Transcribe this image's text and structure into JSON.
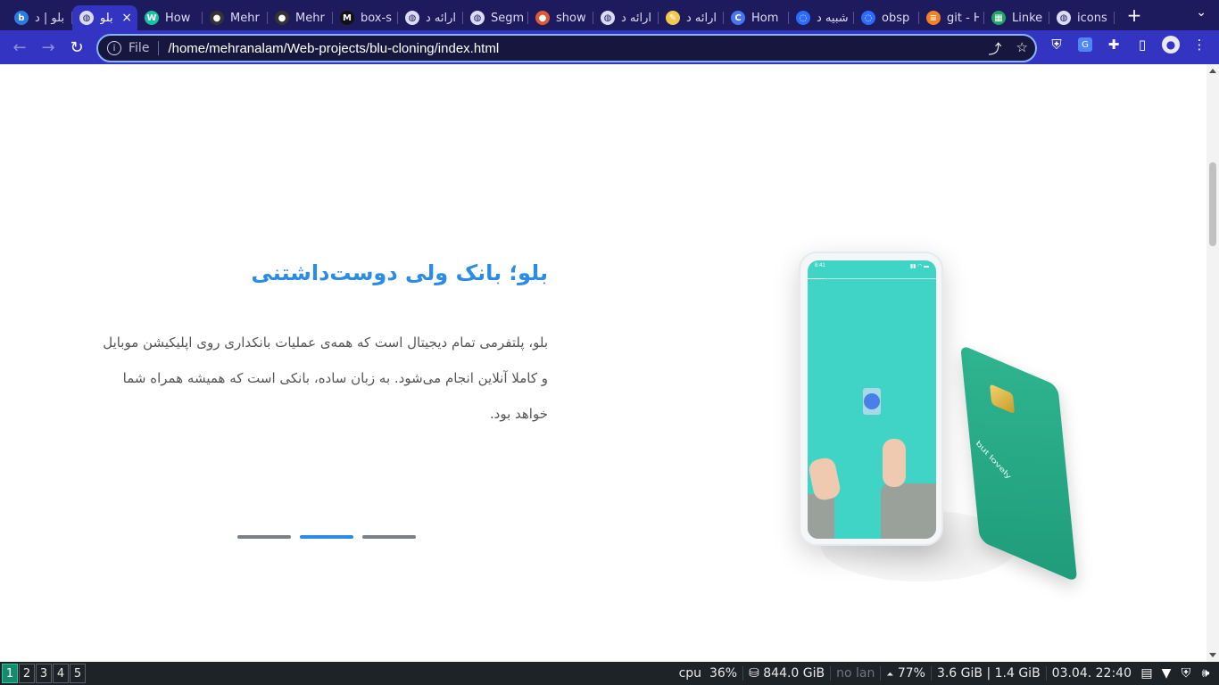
{
  "browser": {
    "tabs": [
      {
        "title": "بلو | د",
        "icon": "blu-favicon",
        "color": "#2a7be4",
        "glyph": "b",
        "active": false
      },
      {
        "title": "بلو",
        "icon": "globe-icon",
        "color": "#dcdcf5",
        "glyph": "◍",
        "active": true
      },
      {
        "title": "How",
        "icon": "w-favicon",
        "color": "#18c2a0",
        "glyph": "W",
        "active": false
      },
      {
        "title": "Mehr",
        "icon": "github-icon",
        "color": "#333333",
        "glyph": "●",
        "active": false
      },
      {
        "title": "Mehr",
        "icon": "github-icon",
        "color": "#333333",
        "glyph": "●",
        "active": false
      },
      {
        "title": "box-s",
        "icon": "m-favicon",
        "color": "#111111",
        "glyph": "M",
        "active": false
      },
      {
        "title": "ارائه د",
        "icon": "globe-icon",
        "color": "#dcdcf5",
        "glyph": "◍",
        "active": false
      },
      {
        "title": "Segm",
        "icon": "globe-icon",
        "color": "#dcdcf5",
        "glyph": "◍",
        "active": false
      },
      {
        "title": "show",
        "icon": "duckduckgo-icon",
        "color": "#de5833",
        "glyph": "●",
        "active": false
      },
      {
        "title": "ارائه د",
        "icon": "globe-icon",
        "color": "#dcdcf5",
        "glyph": "◍",
        "active": false
      },
      {
        "title": "ارائه د",
        "icon": "notes-icon",
        "color": "#f2c94c",
        "glyph": "✎",
        "active": false
      },
      {
        "title": "Hom",
        "icon": "c-favicon",
        "color": "#4a74f0",
        "glyph": "C",
        "active": false
      },
      {
        "title": "شبیه د",
        "icon": "loading-icon",
        "color": "#2b6cff",
        "glyph": "◌",
        "active": false
      },
      {
        "title": "obsp",
        "icon": "loading-icon",
        "color": "#2b6cff",
        "glyph": "◌",
        "active": false
      },
      {
        "title": "git - H",
        "icon": "stackoverflow-icon",
        "color": "#f48024",
        "glyph": "≡",
        "active": false
      },
      {
        "title": "Linke",
        "icon": "sheets-icon",
        "color": "#21a366",
        "glyph": "▦",
        "active": false
      },
      {
        "title": "icons",
        "icon": "globe-icon",
        "color": "#dcdcf5",
        "glyph": "◍",
        "active": false
      }
    ],
    "tab_close": "×",
    "new_tab": "+",
    "tab_menu": "⌄",
    "address": {
      "scheme_label": "File",
      "url": "/home/mehranalam/Web-projects/blu-cloning/index.html"
    }
  },
  "hero": {
    "title": "بلو؛ بانک ولی دوست‌داشتنی",
    "body": "بلو، پلتفرمی تمام دیجیتال است که همه‌ی عملیات بانکداری روی اپلیکیشن موبایل و کاملا آنلاین انجام می‌شود. به زبان ساده، بانکی است که همیشه همراه شما خواهد بود.",
    "card_text": "but lovely",
    "phone_time": "8:41",
    "slider": {
      "count": 3,
      "active": 1
    }
  },
  "colors": {
    "accent": "#2a8ce6",
    "tabstrip": "#1d1b5e",
    "toolbar": "#3434c2",
    "phone_screen": "#3fd4c6",
    "card": "#2fb58f"
  },
  "taskbar": {
    "workspaces": [
      "1",
      "2",
      "3",
      "4",
      "5"
    ],
    "active_workspace": "1",
    "cpu_label": "cpu",
    "cpu_value": "36%",
    "disk": "844.0 GiB",
    "lan": "no lan",
    "battery": "77%",
    "memory": "3.6 GiB | 1.4 GiB",
    "datetime": "03.04. 22:40"
  }
}
